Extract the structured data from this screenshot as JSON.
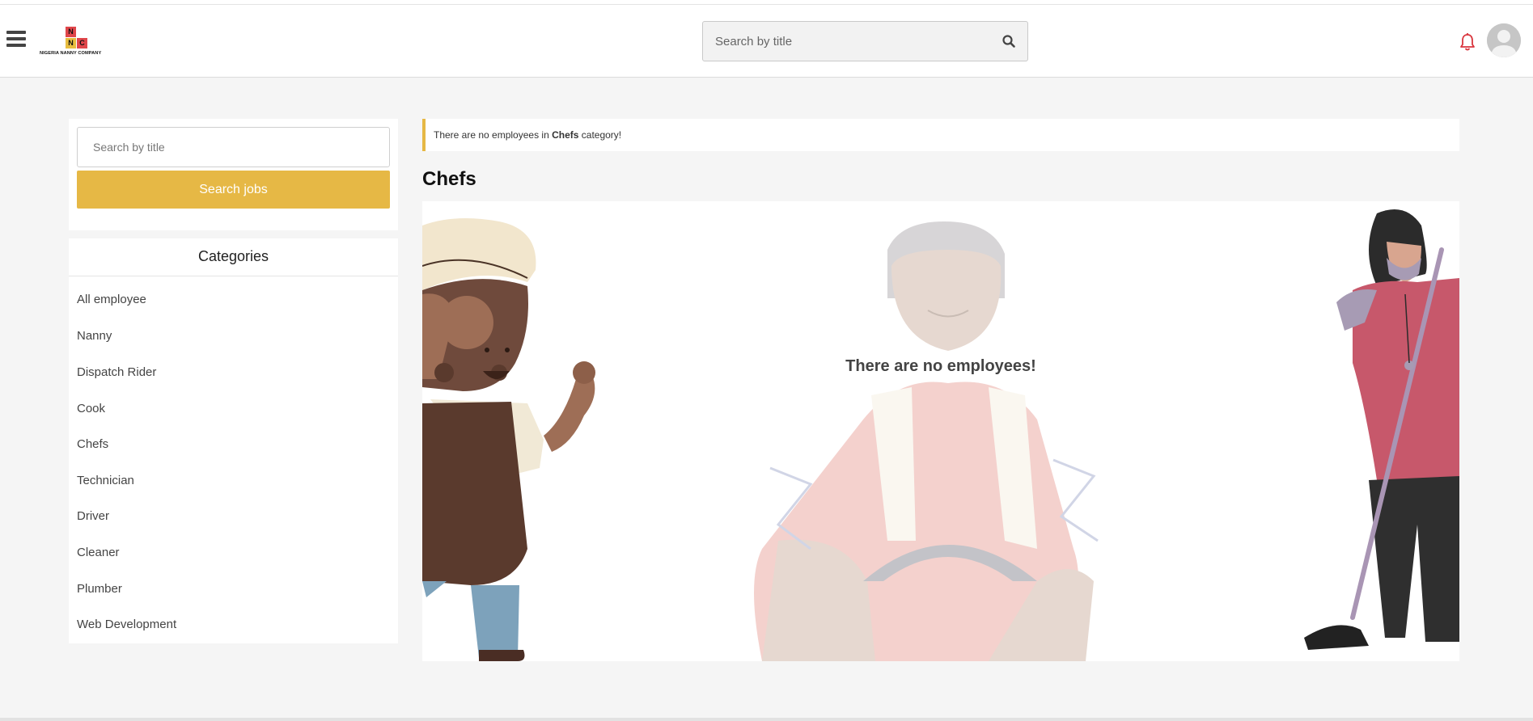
{
  "header": {
    "menu_icon": "hamburger-menu-icon",
    "logo": {
      "letters": [
        "N",
        "N",
        "C"
      ],
      "name": "NIGERIA NANNY COMPANY"
    },
    "search": {
      "placeholder": "Search by title",
      "icon": "search-icon"
    },
    "notification_icon": "bell-icon",
    "notification_color": "#d9363e",
    "avatar_icon": "user-avatar-icon"
  },
  "sidebar": {
    "search": {
      "placeholder": "Search by title",
      "button_label": "Search jobs"
    },
    "categories": {
      "title": "Categories",
      "items": [
        "All employee",
        "Nanny",
        "Dispatch Rider",
        "Cook",
        "Chefs",
        "Technician",
        "Driver",
        "Cleaner",
        "Plumber",
        "Web Development"
      ]
    }
  },
  "main": {
    "alert": {
      "prefix": "There are no employees in",
      "category": "Chefs",
      "suffix": "category!"
    },
    "title": "Chefs",
    "empty_message": "There are no employees!"
  },
  "colors": {
    "accent": "#e6b845",
    "background": "#f5f5f5",
    "panel": "#ffffff"
  }
}
